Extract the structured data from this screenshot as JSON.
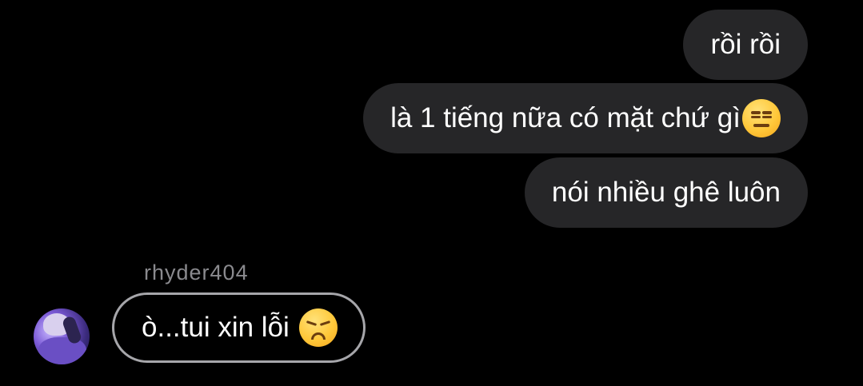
{
  "messages_outgoing": [
    {
      "text": "rồi rồi"
    },
    {
      "text": "là 1 tiếng nữa có mặt chứ gì",
      "emoji": "expressionless-face-emoji"
    },
    {
      "text": "nói nhiều ghê luôn"
    }
  ],
  "incoming": {
    "sender_name": "rhyder404",
    "text": "ò...tui xin lỗi",
    "emoji": "disappointed-face-emoji"
  },
  "colors": {
    "background": "#000000",
    "outgoing_bubble": "#262628",
    "incoming_bubble_border": "#a6a6aa",
    "text": "#ffffff",
    "sender_name": "#8a8a8e"
  }
}
